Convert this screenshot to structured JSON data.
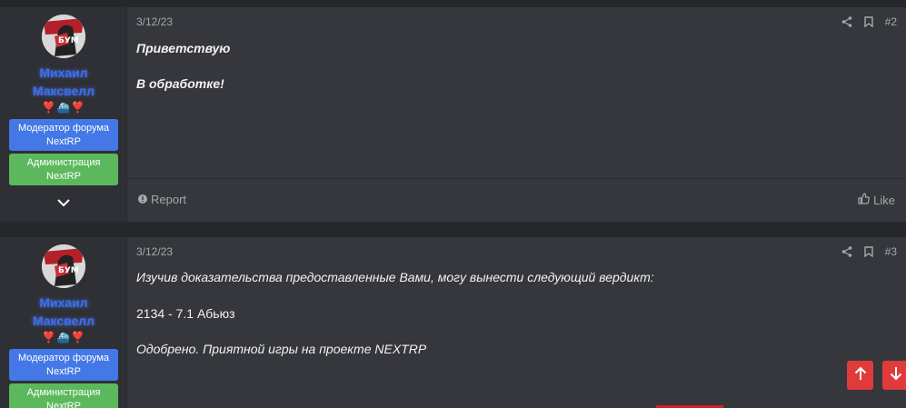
{
  "posts": [
    {
      "date": "3/12/23",
      "number": "#2",
      "user": {
        "name_line1": "Михаил",
        "name_line2": "Максвелл",
        "title_icons": "❣️⛴️❣️",
        "banner_moderator": "Модератор форума NextRP",
        "banner_admin": "Администрация NextRP"
      },
      "lines": [
        "Приветствую",
        "В обработке!"
      ],
      "report_label": "Report",
      "like_label": "Like"
    },
    {
      "date": "3/12/23",
      "number": "#3",
      "user": {
        "name_line1": "Михаил",
        "name_line2": "Максвелл",
        "title_icons": "❣️⛴️❣️",
        "banner_moderator": "Модератор форума NextRP",
        "banner_admin": "Администрация NextRP"
      },
      "lines": [
        "Изучив доказательства предоставленные Вами, могу вынести следующий вердикт:",
        "2134 - 7.1 Абьюз",
        "Одобрено. Приятной игры на проекте NEXTRP"
      ]
    }
  ],
  "icons": {
    "share": "share-icon",
    "bookmark": "bookmark-icon",
    "report": "info-circle-icon",
    "like": "thumbs-up-icon",
    "expand": "chevron-down-icon",
    "scroll_up": "arrow-up-icon",
    "scroll_down": "arrow-down-icon"
  },
  "colors": {
    "username": "#3d6ef0",
    "moderator_banner": "#4378e6",
    "admin_banner": "#5cb85c",
    "scroll_buttons": "#e03b3b"
  }
}
